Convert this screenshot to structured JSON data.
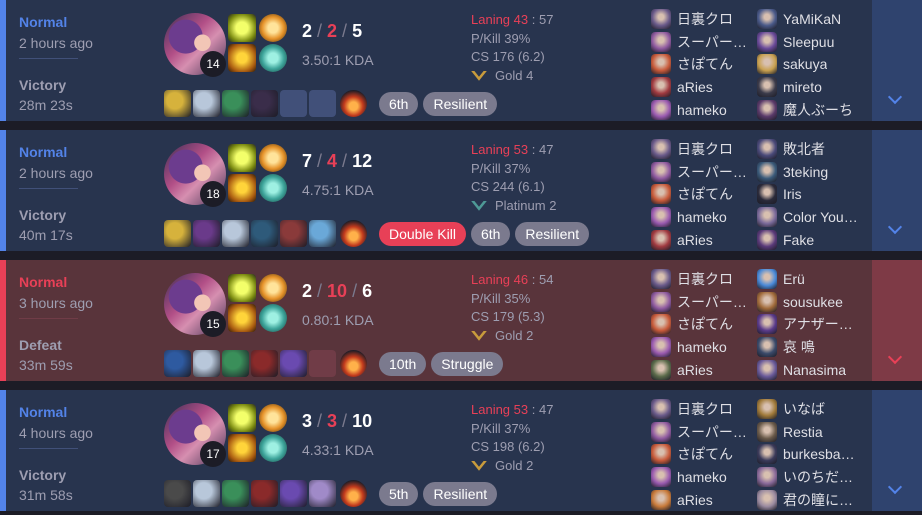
{
  "colors": {
    "win_bg": "#28344e",
    "loss_bg": "#59343b",
    "win_accent": "#5383e8",
    "loss_accent": "#e84057"
  },
  "matches": [
    {
      "outcome": "win",
      "mode": "Normal",
      "time_ago": "2 hours ago",
      "result": "Victory",
      "duration": "28m 23s",
      "level": "14",
      "kills": "2",
      "deaths": "2",
      "assists": "5",
      "kda_ratio": "3.50:1 KDA",
      "laning_label": "Laning 43",
      "laning_opp": "57",
      "pkill": "P/Kill 39%",
      "cs": "CS 176 (6.2)",
      "rank_tier": "gold",
      "rank": "Gold 4",
      "items": [
        "#d6b23c",
        "#b8c7da",
        "#3a8f5a",
        "#3a2d4a",
        "",
        ""
      ],
      "badges": [
        "6th",
        "Resilient"
      ],
      "multikill": "",
      "team1": [
        {
          "name": "日裏クロ",
          "color": "#6a5a8a"
        },
        {
          "name": "スーパー…",
          "color": "#8f5aa0"
        },
        {
          "name": "さぽてん",
          "color": "#c85a3a"
        },
        {
          "name": "aRies",
          "color": "#a03a40"
        },
        {
          "name": "hameko",
          "color": "#9a5ab0"
        }
      ],
      "team2": [
        {
          "name": "YaMiKaN",
          "color": "#4a5a8a"
        },
        {
          "name": "Sleepuu",
          "color": "#6a4a9a"
        },
        {
          "name": "sakuya",
          "color": "#c8a050"
        },
        {
          "name": "mireto",
          "color": "#3a3a4a"
        },
        {
          "name": "魔人ぶーち",
          "color": "#5a3a6a"
        }
      ]
    },
    {
      "outcome": "win",
      "mode": "Normal",
      "time_ago": "2 hours ago",
      "result": "Victory",
      "duration": "40m 17s",
      "level": "18",
      "kills": "7",
      "deaths": "4",
      "assists": "12",
      "kda_ratio": "4.75:1 KDA",
      "laning_label": "Laning 53",
      "laning_opp": "47",
      "pkill": "P/Kill 37%",
      "cs": "CS 244 (6.1)",
      "rank_tier": "platinum",
      "rank": "Platinum 2",
      "items": [
        "#d6b23c",
        "#6a3a8a",
        "#b8c7da",
        "#2e5a7a",
        "#8a3a3a",
        "#6aa8d8",
        ""
      ],
      "badges": [
        "6th",
        "Resilient"
      ],
      "multikill": "Double Kill",
      "team1": [
        {
          "name": "日裏クロ",
          "color": "#6a5a8a"
        },
        {
          "name": "スーパー…",
          "color": "#8f5aa0"
        },
        {
          "name": "さぽてん",
          "color": "#c85a3a"
        },
        {
          "name": "hameko",
          "color": "#9a5ab0"
        },
        {
          "name": "aRies",
          "color": "#a03a40"
        }
      ],
      "team2": [
        {
          "name": "敗北者",
          "color": "#4a4a7a"
        },
        {
          "name": "3teking",
          "color": "#3a5a7a"
        },
        {
          "name": "Iris",
          "color": "#2a2a3a"
        },
        {
          "name": "Color You…",
          "color": "#7a6a9a"
        },
        {
          "name": "Fake",
          "color": "#5a3a7a"
        }
      ]
    },
    {
      "outcome": "loss",
      "mode": "Normal",
      "time_ago": "3 hours ago",
      "result": "Defeat",
      "duration": "33m 59s",
      "level": "15",
      "kills": "2",
      "deaths": "10",
      "assists": "6",
      "kda_ratio": "0.80:1 KDA",
      "laning_label": "Laning 46",
      "laning_opp": "54",
      "pkill": "P/Kill 35%",
      "cs": "CS 179 (5.3)",
      "rank_tier": "gold",
      "rank": "Gold 2",
      "items": [
        "#2e5aa0",
        "#b8c7da",
        "#3a8f5a",
        "#8a2a2a",
        "#6a4ab0",
        ""
      ],
      "badges": [
        "10th",
        "Struggle"
      ],
      "multikill": "",
      "team1": [
        {
          "name": "日裏クロ",
          "color": "#6a5a8a"
        },
        {
          "name": "スーパー…",
          "color": "#8f5aa0"
        },
        {
          "name": "さぽてん",
          "color": "#c85a3a"
        },
        {
          "name": "hameko",
          "color": "#9a5ab0"
        },
        {
          "name": "aRies",
          "color": "#5a6a4a"
        }
      ],
      "team2": [
        {
          "name": "Erü",
          "color": "#4a8ad8"
        },
        {
          "name": "sousukee",
          "color": "#a06a3a"
        },
        {
          "name": "アナザー…",
          "color": "#5a3a8a"
        },
        {
          "name": "哀 鳴",
          "color": "#3a4a6a"
        },
        {
          "name": "Nanasima",
          "color": "#6a5a9a"
        }
      ]
    },
    {
      "outcome": "win",
      "mode": "Normal",
      "time_ago": "4 hours ago",
      "result": "Victory",
      "duration": "31m 58s",
      "level": "17",
      "kills": "3",
      "deaths": "3",
      "assists": "10",
      "kda_ratio": "4.33:1 KDA",
      "laning_label": "Laning 53",
      "laning_opp": "47",
      "pkill": "P/Kill 37%",
      "cs": "CS 198 (6.2)",
      "rank_tier": "gold",
      "rank": "Gold 2",
      "items": [
        "#4a4a4a",
        "#b8c7da",
        "#3a8f5a",
        "#8a2a2a",
        "#6a4ab0",
        "#a08ac8"
      ],
      "badges": [
        "5th",
        "Resilient"
      ],
      "multikill": "",
      "team1": [
        {
          "name": "日裏クロ",
          "color": "#6a5a8a"
        },
        {
          "name": "スーパー…",
          "color": "#8f5aa0"
        },
        {
          "name": "さぽてん",
          "color": "#c85a3a"
        },
        {
          "name": "hameko",
          "color": "#9a5ab0"
        },
        {
          "name": "aRies",
          "color": "#c87a3a"
        }
      ],
      "team2": [
        {
          "name": "いなば",
          "color": "#a07a3a"
        },
        {
          "name": "Restia",
          "color": "#6a5a4a"
        },
        {
          "name": "burkesba…",
          "color": "#3a3a5a"
        },
        {
          "name": "いのちだ…",
          "color": "#8a6a9a"
        },
        {
          "name": "君の瞳に…",
          "color": "#9a8aa0"
        }
      ]
    }
  ]
}
